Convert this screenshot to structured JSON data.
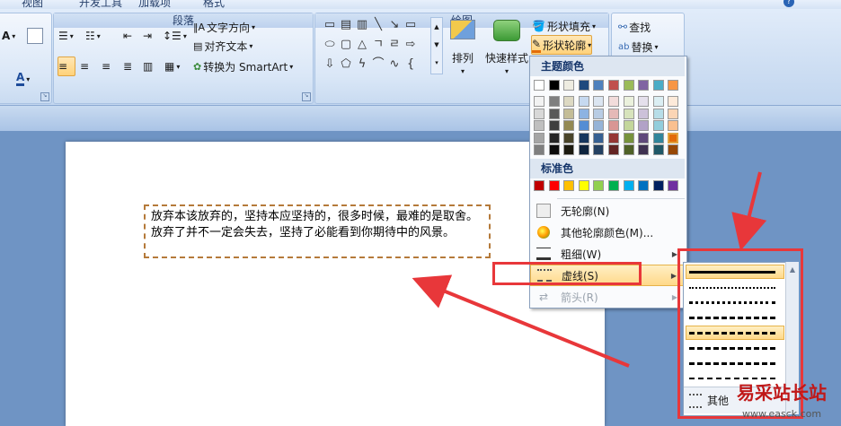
{
  "ribbon": {
    "tabs": [
      "视图",
      "开发工具",
      "加载项",
      "格式"
    ],
    "paragraph": {
      "label": "段落",
      "text_direction": "文字方向",
      "align_text": "对齐文本",
      "convert_smartart": "转换为 SmartArt"
    },
    "drawing": {
      "label": "绘图",
      "arrange": "排列",
      "quick_styles": "快速样式",
      "shape_fill": "形状填充",
      "shape_outline": "形状轮廓"
    },
    "editing": {
      "find": "查找",
      "replace": "替换"
    }
  },
  "textbox": {
    "text": "放弃本该放弃的，坚持本应坚持的，很多时候，最难的是取舍。放弃了并不一定会失去，坚持了必能看到你期待中的风景。"
  },
  "outline_menu": {
    "theme_colors_label": "主题颜色",
    "standard_colors_label": "标准色",
    "no_outline": "无轮廓(N)",
    "more_colors": "其他轮廓颜色(M)...",
    "weight": "粗细(W)",
    "dashes": "虚线(S)",
    "arrows": "箭头(R)",
    "theme_top_row": [
      "#ffffff",
      "#000000",
      "#eeece1",
      "#1f497d",
      "#4f81bd",
      "#c0504d",
      "#9bbb59",
      "#8064a2",
      "#4bacc6",
      "#f79646"
    ],
    "theme_shade_rows": [
      [
        "#f2f2f2",
        "#7f7f7f",
        "#ddd9c3",
        "#c6d9f0",
        "#dbe5f1",
        "#f2dcdb",
        "#ebf1dd",
        "#e5e0ec",
        "#dbeef3",
        "#fdeada"
      ],
      [
        "#d8d8d8",
        "#595959",
        "#c4bd97",
        "#8db3e2",
        "#b8cce4",
        "#e5b9b7",
        "#d7e3bc",
        "#ccc1d9",
        "#b7dde8",
        "#fbd5b5"
      ],
      [
        "#bfbfbf",
        "#3f3f3f",
        "#938953",
        "#548dd4",
        "#95b3d7",
        "#d99694",
        "#c3d69b",
        "#b2a2c7",
        "#92cddc",
        "#fac08f"
      ],
      [
        "#a5a5a5",
        "#262626",
        "#494429",
        "#17365d",
        "#366092",
        "#953734",
        "#76923c",
        "#5f497a",
        "#31859b",
        "#e36c09"
      ],
      [
        "#7f7f7f",
        "#0c0c0c",
        "#1d1b10",
        "#0f243e",
        "#244061",
        "#632423",
        "#4f6128",
        "#3f3151",
        "#205867",
        "#974806"
      ]
    ],
    "standard_colors": [
      "#c00000",
      "#ff0000",
      "#ffc000",
      "#ffff00",
      "#92d050",
      "#00b050",
      "#00b0f0",
      "#0070c0",
      "#002060",
      "#7030a0"
    ],
    "selected_color": "#e36c09"
  },
  "dash_submenu": {
    "more_lines": "其他"
  },
  "watermark": {
    "title": "易采站长站",
    "url": "www.easck.com"
  }
}
